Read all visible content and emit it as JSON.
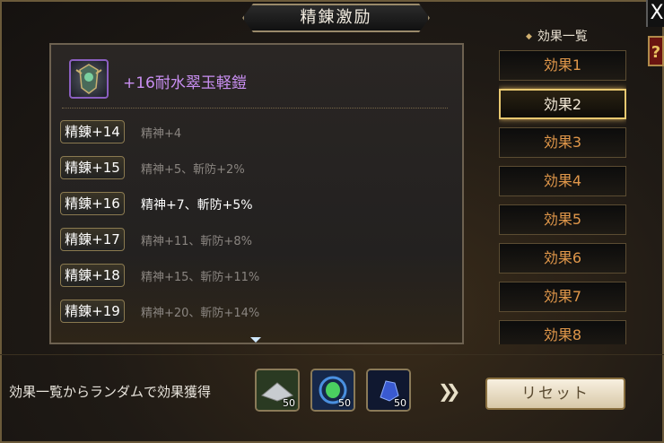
{
  "window": {
    "title": "精錬激励",
    "close_glyph": "X",
    "help_glyph": "?"
  },
  "item": {
    "name": "+16耐水翠玉軽鎧",
    "icon": "armor-icon"
  },
  "refine_rows": [
    {
      "level": "精錬+14",
      "effect": "精神+4",
      "active": false
    },
    {
      "level": "精錬+15",
      "effect": "精神+5、斬防+2%",
      "active": false
    },
    {
      "level": "精錬+16",
      "effect": "精神+7、斬防+5%",
      "active": true
    },
    {
      "level": "精錬+17",
      "effect": "精神+11、斬防+8%",
      "active": false
    },
    {
      "level": "精錬+18",
      "effect": "精神+15、斬防+11%",
      "active": false
    },
    {
      "level": "精錬+19",
      "effect": "精神+20、斬防+14%",
      "active": false
    }
  ],
  "effects_panel": {
    "header": "効果一覧",
    "items": [
      "効果1",
      "効果2",
      "効果3",
      "効果4",
      "効果5",
      "効果6",
      "効果7",
      "効果8"
    ],
    "selected_index": 1
  },
  "footer": {
    "random_text": "効果一覧からランダムで効果獲得",
    "materials": [
      {
        "icon": "silver-plate-icon",
        "qty": "50"
      },
      {
        "icon": "green-gem-icon",
        "qty": "50"
      },
      {
        "icon": "blue-crystal-icon",
        "qty": "50"
      }
    ],
    "reset_label": "リセット"
  },
  "colors": {
    "item_name": "#c98ff2",
    "effect_button_text": "#e0974a",
    "selected_border": "#e8c870"
  }
}
